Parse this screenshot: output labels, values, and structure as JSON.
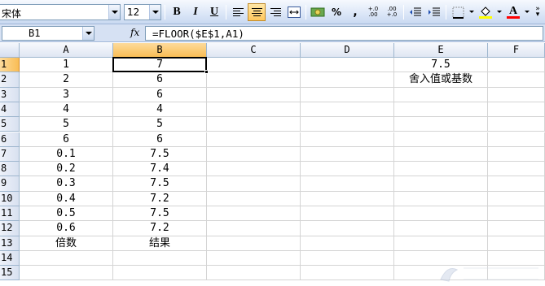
{
  "toolbar": {
    "font_name": "宋体",
    "font_size": "12",
    "bold_label": "B",
    "italic_label": "I",
    "underline_label": "U",
    "percent_label": "%",
    "comma_label": ",",
    "inc_decimal_label": "+.0 .00",
    "dec_decimal_label": ".00 +.0",
    "font_color_label": "A"
  },
  "formula_bar": {
    "name_box": "B1",
    "fx_label": "fx",
    "formula": "=FLOOR($E$1,A1)"
  },
  "columns": [
    "A",
    "B",
    "C",
    "D",
    "E",
    "F"
  ],
  "rows": [
    "1",
    "2",
    "3",
    "4",
    "5",
    "6",
    "7",
    "8",
    "9",
    "10",
    "11",
    "12",
    "13",
    "14",
    "15"
  ],
  "cells": {
    "A": [
      "1",
      "2",
      "3",
      "4",
      "5",
      "6",
      "0.1",
      "0.2",
      "0.3",
      "0.4",
      "0.5",
      "0.6",
      "倍数",
      "",
      ""
    ],
    "B": [
      "7",
      "6",
      "6",
      "4",
      "5",
      "6",
      "7.5",
      "7.4",
      "7.5",
      "7.2",
      "7.5",
      "7.2",
      "结果",
      "",
      ""
    ],
    "E": [
      "7.5",
      "舍入值或基数",
      "",
      "",
      "",
      "",
      "",
      "",
      "",
      "",
      "",
      "",
      "",
      "",
      ""
    ]
  },
  "selection": {
    "cell": "B1",
    "column": "B",
    "row": "1"
  },
  "colors": {
    "toolbar_bg": "#dbe6f7",
    "header_selected": "#f9bd55",
    "gridline": "#d4d4d4",
    "font_color_indicator": "#ff0000",
    "fill_color_indicator": "#ffff00"
  }
}
